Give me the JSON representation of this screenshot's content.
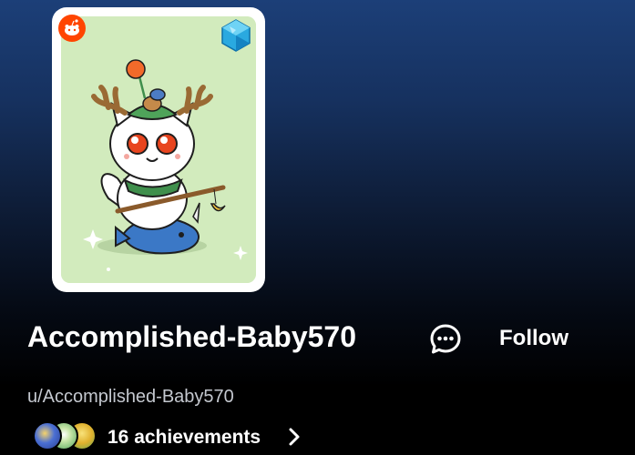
{
  "profile": {
    "display_name": "Accomplished-Baby570",
    "username": "u/Accomplished-Baby570",
    "follow_label": "Follow",
    "avatar_icon": "snoo-avatar-deer-cat-on-whale",
    "chat_icon": "chat-bubble-icon"
  },
  "achievements": {
    "label": "16 achievements",
    "badge_icons": [
      "achievement-badge-blue",
      "achievement-badge-green",
      "achievement-badge-gold"
    ]
  },
  "colors": {
    "background_top": "#1c3f78",
    "background_bottom": "#000000",
    "reddit_orange": "#ff4500",
    "avatar_bg": "#d2ebbd",
    "username_text": "#c4c8cf"
  }
}
